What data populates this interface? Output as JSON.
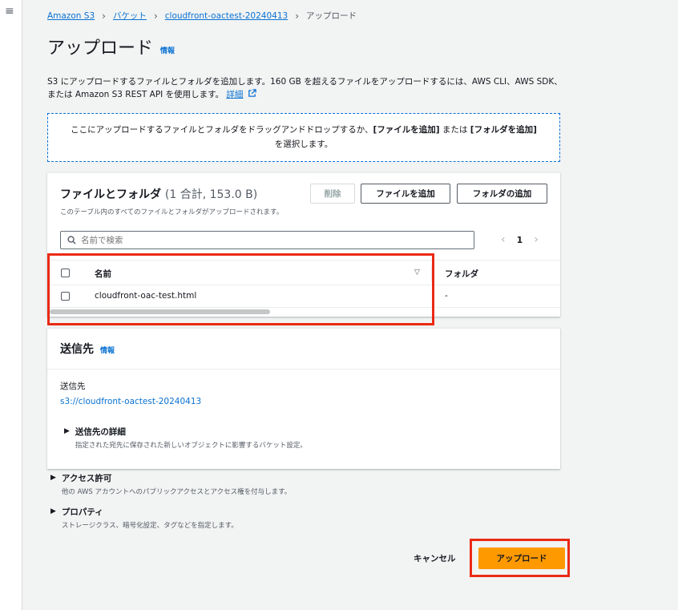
{
  "breadcrumb": {
    "items": [
      "Amazon S3",
      "バケット",
      "cloudfront-oactest-20240413"
    ],
    "current": "アップロード"
  },
  "page": {
    "title": "アップロード",
    "info": "情報",
    "description": "S3 にアップロードするファイルとフォルダを追加します。160 GB を超えるファイルをアップロードするには、AWS CLI、AWS SDK、または Amazon S3 REST API を使用します。",
    "more_link": "詳細"
  },
  "dropzone": {
    "text_before": "ここにアップロードするファイルとフォルダをドラッグアンドドロップするか、",
    "add_files": "[ファイルを追加]",
    "middle": " または ",
    "add_folder": "[フォルダを追加]",
    "text_after": "を選択します。"
  },
  "files": {
    "title": "ファイルとフォルダ",
    "count": "(1 合計, 153.0 B)",
    "subtitle": "このテーブル内のすべてのファイルとフォルダがアップロードされます。",
    "buttons": {
      "delete": "削除",
      "add_files": "ファイルを追加",
      "add_folder": "フォルダの追加"
    },
    "search_placeholder": "名前で検索",
    "pagination": {
      "page": "1"
    },
    "columns": {
      "name": "名前",
      "folder": "フォルダ"
    },
    "rows": [
      {
        "name": "cloudfront-oac-test.html",
        "folder": "-"
      }
    ]
  },
  "destination": {
    "title": "送信先",
    "info": "情報",
    "label": "送信先",
    "url": "s3://cloudfront-oactest-20240413",
    "details_title": "送信先の詳細",
    "details_desc": "指定された宛先に保存された新しいオブジェクトに影響するバケット設定。"
  },
  "access": {
    "title": "アクセス許可",
    "desc": "他の AWS アカウントへのパブリックアクセスとアクセス権を付与します。"
  },
  "properties": {
    "title": "プロパティ",
    "desc": "ストレージクラス、暗号化設定、タグなどを指定します。"
  },
  "actions": {
    "cancel": "キャンセル",
    "upload": "アップロード"
  },
  "colors": {
    "accent": "#0972d3",
    "primary_button": "#ff9900",
    "highlight": "#ea2a15"
  }
}
